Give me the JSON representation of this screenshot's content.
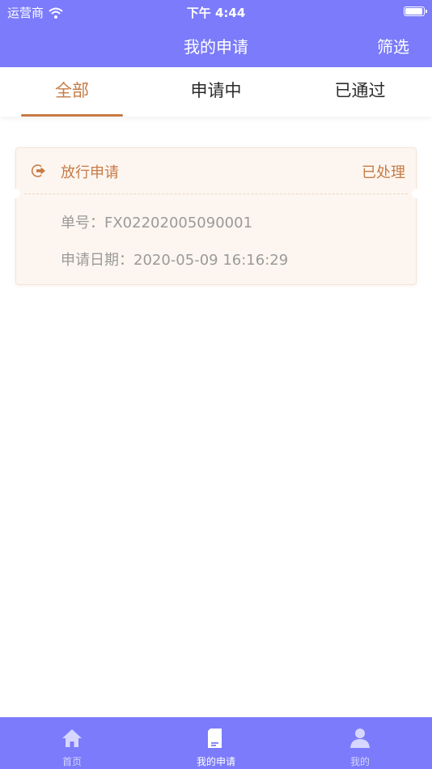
{
  "status_bar": {
    "carrier": "运营商",
    "time": "下午 4:44",
    "battery_level": 0.95,
    "icons": [
      "wifi-icon",
      "battery-icon"
    ]
  },
  "nav": {
    "title": "我的申请",
    "filter_label": "筛选"
  },
  "tabs": [
    {
      "label": "全部",
      "active": true
    },
    {
      "label": "申请中",
      "active": false
    },
    {
      "label": "已通过",
      "active": false
    }
  ],
  "applications": [
    {
      "icon": "exit-arrow-icon",
      "title": "放行申请",
      "status": "已处理",
      "order_no_label": "单号：",
      "order_no": "FX02202005090001",
      "date_label": "申请日期：",
      "date": "2020-05-09 16:16:29"
    }
  ],
  "tabbar": [
    {
      "label": "首页",
      "icon": "home-icon",
      "active": false
    },
    {
      "label": "我的申请",
      "icon": "document-icon",
      "active": true
    },
    {
      "label": "我的",
      "icon": "person-icon",
      "active": false
    }
  ],
  "colors": {
    "primary": "#7b7bfb",
    "accent": "#c77a45",
    "card_background": "#fdf6f0",
    "muted_text": "#9a9a9a"
  }
}
